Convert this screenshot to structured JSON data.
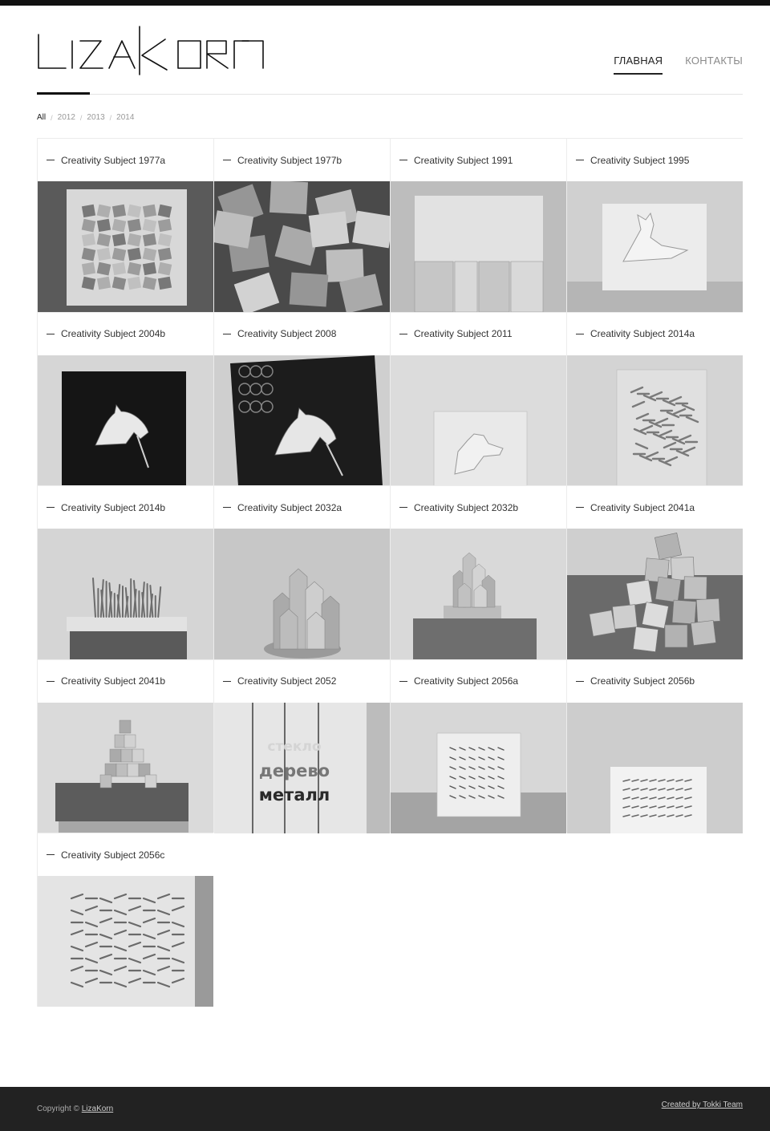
{
  "brand": {
    "name": "LizaKorn"
  },
  "nav": {
    "items": [
      {
        "label": "ГЛАВНАЯ",
        "active": true
      },
      {
        "label": "КОНТАКТЫ",
        "active": false
      }
    ]
  },
  "filters": {
    "items": [
      {
        "label": "All",
        "active": true
      },
      {
        "label": "2012",
        "active": false
      },
      {
        "label": "2013",
        "active": false
      },
      {
        "label": "2014",
        "active": false
      }
    ],
    "separator": "/"
  },
  "works": [
    {
      "title": "Creativity Subject 1977a",
      "scene": "cubes-panel"
    },
    {
      "title": "Creativity Subject 1977b",
      "scene": "cubes-closeup"
    },
    {
      "title": "Creativity Subject 1991",
      "scene": "planks-board"
    },
    {
      "title": "Creativity Subject 1995",
      "scene": "giraffe-board"
    },
    {
      "title": "Creativity Subject 2004b",
      "scene": "horse-dark"
    },
    {
      "title": "Creativity Subject 2008",
      "scene": "horse-graffiti"
    },
    {
      "title": "Creativity Subject 2011",
      "scene": "dog-board"
    },
    {
      "title": "Creativity Subject 2014a",
      "scene": "twigs-board"
    },
    {
      "title": "Creativity Subject 2014b",
      "scene": "twigs-box"
    },
    {
      "title": "Creativity Subject 2032a",
      "scene": "towers-large"
    },
    {
      "title": "Creativity Subject 2032b",
      "scene": "towers-small"
    },
    {
      "title": "Creativity Subject 2041a",
      "scene": "cubes-pile"
    },
    {
      "title": "Creativity Subject 2041b",
      "scene": "pyramid"
    },
    {
      "title": "Creativity Subject 2052",
      "scene": "text-board",
      "image_text": [
        "стекло",
        "дерево",
        "металл"
      ]
    },
    {
      "title": "Creativity Subject 2056a",
      "scene": "nails-small"
    },
    {
      "title": "Creativity Subject 2056b",
      "scene": "nails-medium"
    },
    {
      "title": "Creativity Subject 2056c",
      "scene": "nails-closeup"
    }
  ],
  "footer": {
    "copyright_prefix": "Copyright ©",
    "copyright_link": "LizaKorn",
    "credit": "Created by Tokki Team"
  },
  "colors": {
    "footer_bg": "#222222",
    "accent": "#111111",
    "muted": "#8a8a8a"
  }
}
